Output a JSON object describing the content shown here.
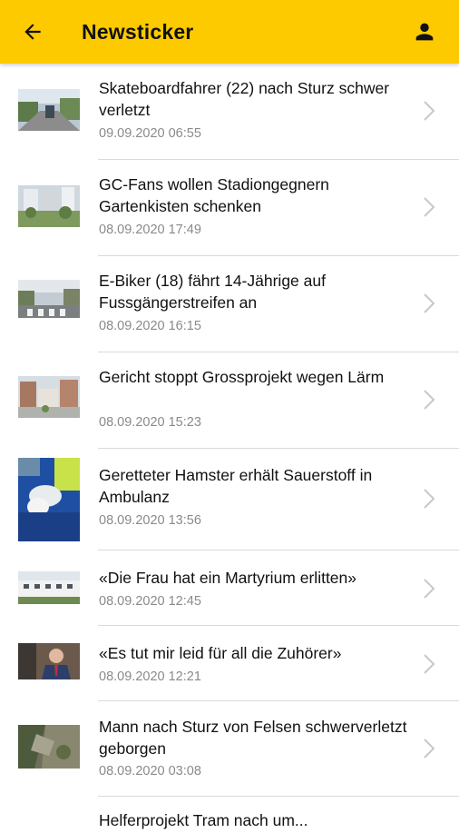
{
  "header": {
    "title": "Newsticker",
    "back_icon": "arrow-left-icon",
    "profile_icon": "person-icon",
    "background_color": "#fdca00"
  },
  "articles": [
    {
      "headline": "Skateboardfahrer (22) nach Sturz schwer verletzt",
      "timestamp": "09.09.2020 06:55",
      "thumbnail": "street-scene-photo"
    },
    {
      "headline": "GC-Fans wollen Stadiongegnern Gartenkisten schenken",
      "timestamp": "08.09.2020 17:49",
      "thumbnail": "building-rendering-photo"
    },
    {
      "headline": "E-Biker (18) fährt 14-Jährige auf Fussgängerstreifen an",
      "timestamp": "08.09.2020 16:15",
      "thumbnail": "crosswalk-photo"
    },
    {
      "headline": "Gericht stoppt Grossprojekt wegen Lärm",
      "timestamp": "08.09.2020 15:23",
      "thumbnail": "apartment-blocks-photo"
    },
    {
      "headline": "Geretteter Hamster erhält Sauerstoff in Ambulanz",
      "timestamp": "08.09.2020 13:56",
      "thumbnail": "paramedic-hamster-photo"
    },
    {
      "headline": "«Die Frau hat ein Martyrium erlitten»",
      "timestamp": "08.09.2020 12:45",
      "thumbnail": "house-photo"
    },
    {
      "headline": "«Es tut mir leid für all die Zuhörer»",
      "timestamp": "08.09.2020 12:21",
      "thumbnail": "man-in-suit-photo"
    },
    {
      "headline": "Mann nach Sturz von Felsen schwerverletzt geborgen",
      "timestamp": "08.09.2020 03:08",
      "thumbnail": "aerial-rocks-photo"
    },
    {
      "headline": "Helferprojekt Tram nach um...",
      "timestamp": "",
      "thumbnail": ""
    }
  ]
}
